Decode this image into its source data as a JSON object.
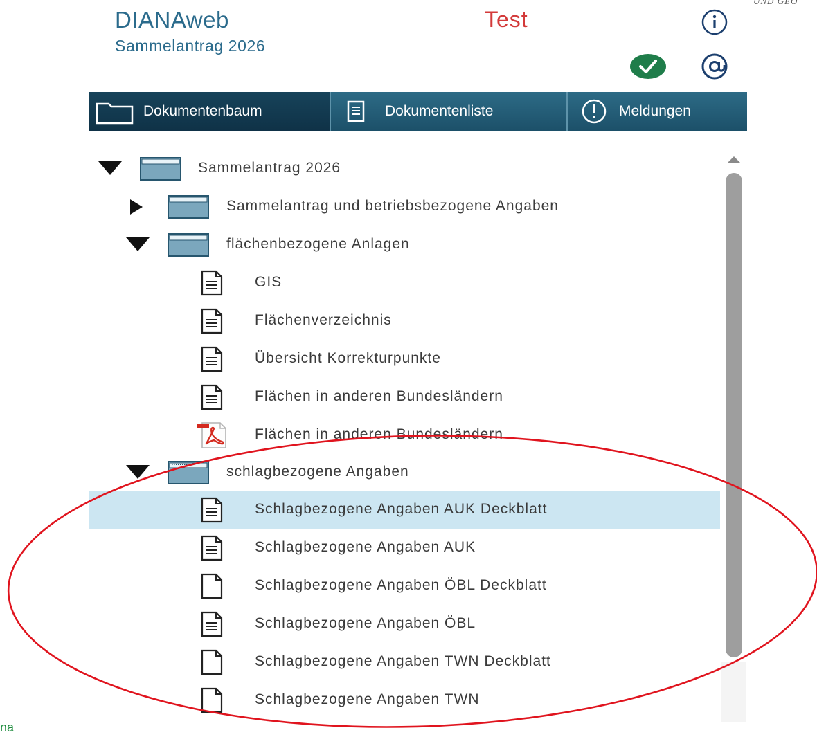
{
  "header": {
    "app_title": "DIANAweb",
    "subtitle": "Sammelantrag 2026",
    "environment": "Test",
    "corner_text": "UND GEO",
    "icons": {
      "info": "info-icon",
      "status": "check-circle-icon",
      "email": "at-sign-icon"
    },
    "colors": {
      "title": "#2b6b8c",
      "environment": "#d33a3a",
      "status_ok": "#1f7d4a"
    }
  },
  "tabs": [
    {
      "label": "Dokumentenbaum",
      "icon": "folder-icon",
      "active": true
    },
    {
      "label": "Dokumentenliste",
      "icon": "document-list-icon",
      "active": false
    },
    {
      "label": "Meldungen",
      "icon": "exclamation-circle-icon",
      "active": false
    }
  ],
  "tree": {
    "root": {
      "label": "Sammelantrag 2026",
      "expanded": true
    },
    "sections": [
      {
        "label": "Sammelantrag und betriebsbezogene Angaben",
        "expanded": false
      },
      {
        "label": "flächenbezogene Anlagen",
        "expanded": true
      },
      {
        "label": "schlagbezogene Angaben",
        "expanded": true
      }
    ],
    "area_documents": [
      {
        "label": "GIS",
        "icon": "document-filled-icon"
      },
      {
        "label": "Flächenverzeichnis",
        "icon": "document-filled-icon"
      },
      {
        "label": "Übersicht Korrekturpunkte",
        "icon": "document-filled-icon"
      },
      {
        "label": "Flächen in anderen Bundesländern",
        "icon": "document-filled-icon"
      },
      {
        "label": "Flächen in anderen Bundesländern",
        "icon": "pdf-icon"
      }
    ],
    "plot_documents": [
      {
        "label": "Schlagbezogene Angaben AUK Deckblatt",
        "icon": "document-filled-icon",
        "selected": true
      },
      {
        "label": "Schlagbezogene Angaben AUK",
        "icon": "document-filled-icon",
        "selected": false
      },
      {
        "label": "Schlagbezogene Angaben ÖBL Deckblatt",
        "icon": "document-empty-icon",
        "selected": false
      },
      {
        "label": "Schlagbezogene Angaben ÖBL",
        "icon": "document-filled-icon",
        "selected": false
      },
      {
        "label": "Schlagbezogene Angaben TWN Deckblatt",
        "icon": "document-empty-icon",
        "selected": false
      },
      {
        "label": "Schlagbezogene Angaben TWN",
        "icon": "document-empty-icon",
        "selected": false
      }
    ],
    "colors": {
      "selected_row": "#cce6f2",
      "tab_bar": "#1c5069"
    }
  },
  "annotation": {
    "ellipse_color": "#e0141e"
  },
  "footer_fragment": "na"
}
